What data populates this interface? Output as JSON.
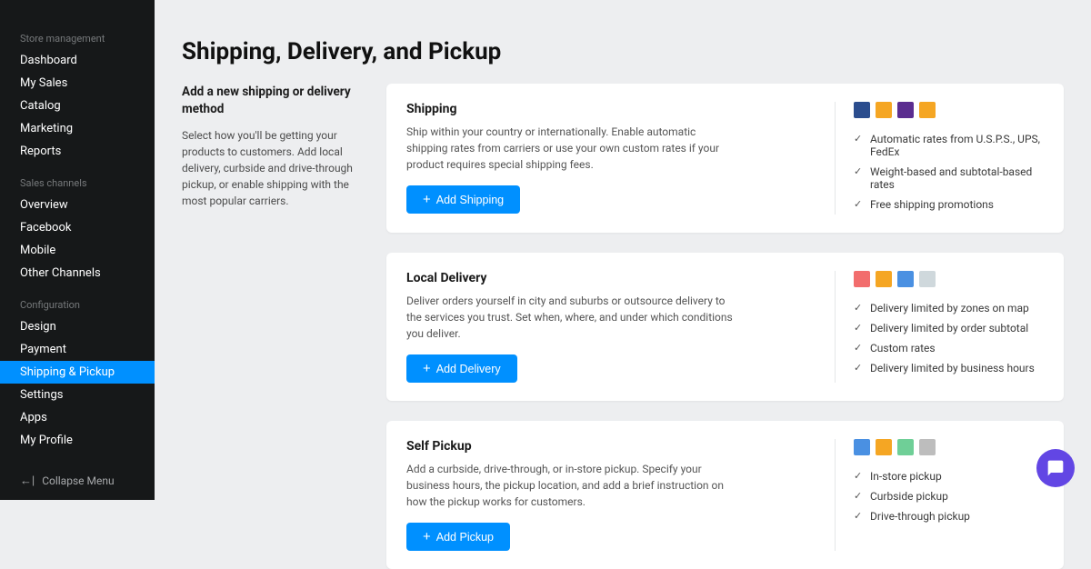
{
  "sidebar": {
    "groups": [
      {
        "heading": "Store management",
        "items": [
          {
            "label": "Dashboard",
            "active": false
          },
          {
            "label": "My Sales",
            "active": false
          },
          {
            "label": "Catalog",
            "active": false
          },
          {
            "label": "Marketing",
            "active": false
          },
          {
            "label": "Reports",
            "active": false
          }
        ]
      },
      {
        "heading": "Sales channels",
        "items": [
          {
            "label": "Overview",
            "active": false
          },
          {
            "label": "Facebook",
            "active": false
          },
          {
            "label": "Mobile",
            "active": false
          },
          {
            "label": "Other Channels",
            "active": false
          }
        ]
      },
      {
        "heading": "Configuration",
        "items": [
          {
            "label": "Design",
            "active": false
          },
          {
            "label": "Payment",
            "active": false
          },
          {
            "label": "Shipping & Pickup",
            "active": true
          },
          {
            "label": "Settings",
            "active": false
          },
          {
            "label": "Apps",
            "active": false
          },
          {
            "label": "My Profile",
            "active": false
          }
        ]
      }
    ],
    "collapse_label": "Collapse Menu"
  },
  "page": {
    "title": "Shipping, Delivery, and Pickup",
    "intro_heading": "Add a new shipping or delivery method",
    "intro_text": "Select how you'll be getting your products to customers. Add local delivery, curbside and drive-through pickup, or enable shipping with the most popular carriers."
  },
  "cards": [
    {
      "title": "Shipping",
      "desc": "Ship within your country or internationally. Enable automatic shipping rates from carriers or use your own custom rates if your product requires special shipping fees.",
      "button": "Add Shipping",
      "icons": [
        {
          "name": "usps-icon",
          "color": "#2b4d8e"
        },
        {
          "name": "ups-icon",
          "color": "#f5a623"
        },
        {
          "name": "fedex-icon",
          "color": "#5b2d90"
        },
        {
          "name": "calendar-icon",
          "color": "#f5a623"
        }
      ],
      "features": [
        "Automatic rates from U.S.P.S., UPS, FedEx",
        "Weight-based and subtotal-based rates",
        "Free shipping promotions"
      ]
    },
    {
      "title": "Local Delivery",
      "desc": "Deliver orders yourself in city and suburbs or outsource delivery to the services you trust. Set when, where, and under which conditions you deliver.",
      "button": "Add Delivery",
      "icons": [
        {
          "name": "pin-icon",
          "color": "#f26d6d"
        },
        {
          "name": "price-icon",
          "color": "#f5a623"
        },
        {
          "name": "calendar-icon",
          "color": "#4a90e2"
        },
        {
          "name": "schedule-icon",
          "color": "#cfd8dc"
        }
      ],
      "features": [
        "Delivery limited by zones on map",
        "Delivery limited by order subtotal",
        "Custom rates",
        "Delivery limited by business hours"
      ]
    },
    {
      "title": "Self Pickup",
      "desc": "Add a curbside, drive-through, or in-store pickup. Specify your business hours, the pickup location, and add a brief instruction on how the pickup works for customers.",
      "button": "Add Pickup",
      "icons": [
        {
          "name": "person-icon",
          "color": "#4a90e2"
        },
        {
          "name": "store-icon",
          "color": "#f5a623"
        },
        {
          "name": "car-icon",
          "color": "#6fcf97"
        },
        {
          "name": "building-icon",
          "color": "#bdbdbd"
        }
      ],
      "features": [
        "In-store pickup",
        "Curbside pickup",
        "Drive-through pickup"
      ]
    }
  ],
  "chat": {
    "label": "chat"
  }
}
